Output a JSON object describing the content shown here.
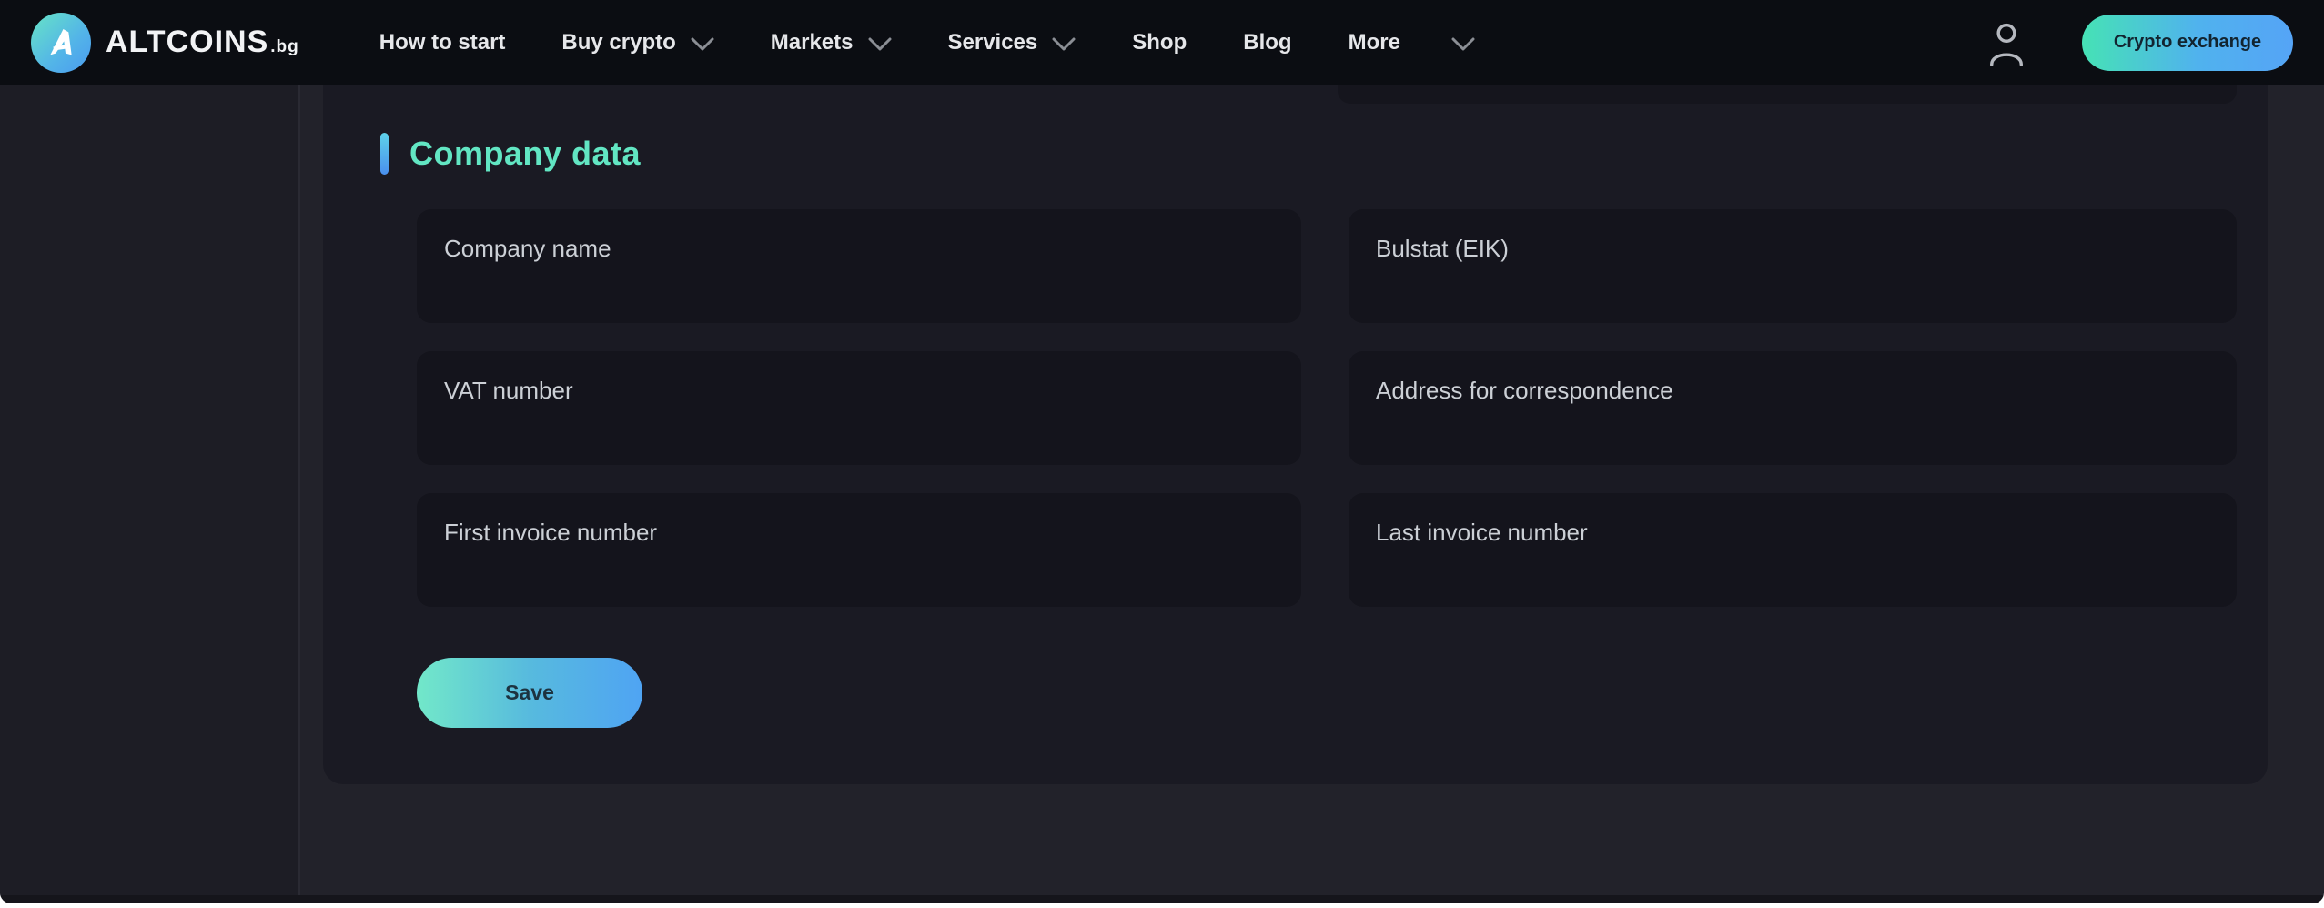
{
  "navbar": {
    "logo": {
      "brand": "ALTCOINS",
      "tld": ".bg"
    },
    "items": [
      {
        "label": "How to start",
        "has_chevron": false
      },
      {
        "label": "Buy crypto",
        "has_chevron": true
      },
      {
        "label": "Markets",
        "has_chevron": true
      },
      {
        "label": "Services",
        "has_chevron": true
      },
      {
        "label": "Shop",
        "has_chevron": false
      },
      {
        "label": "Blog",
        "has_chevron": false
      },
      {
        "label": "More",
        "has_chevron": true
      }
    ],
    "cta_label": "Crypto exchange"
  },
  "section": {
    "title": "Company data",
    "fields": [
      {
        "label": "Company name",
        "value": ""
      },
      {
        "label": "Bulstat (EIK)",
        "value": ""
      },
      {
        "label": "VAT number",
        "value": ""
      },
      {
        "label": "Address for correspondence",
        "value": ""
      },
      {
        "label": "First invoice number",
        "value": ""
      },
      {
        "label": "Last invoice number",
        "value": ""
      }
    ],
    "save_label": "Save"
  },
  "colors": {
    "navbar_bg": "#0b0d12",
    "page_bg": "#22222a",
    "card_bg": "#1a1a23",
    "field_bg": "#14141c",
    "heading_text": "#62e6c3",
    "accent_bar_top": "#5ed2e9",
    "accent_bar_bottom": "#4a90ee",
    "save_gradient_left": "#72e8c9",
    "save_gradient_right": "#4fa4f3",
    "cta_gradient_left": "#46e2b5",
    "cta_gradient_right": "#55a4f6",
    "label_text": "#ccd0d6"
  }
}
